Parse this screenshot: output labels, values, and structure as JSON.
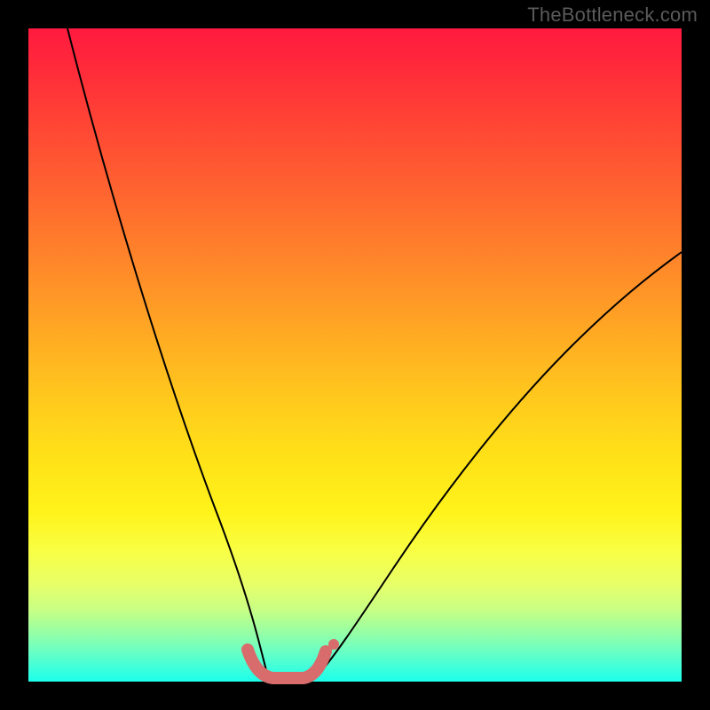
{
  "watermark": "TheBottleneck.com",
  "colors": {
    "frame": "#000000",
    "curve": "#000000",
    "highlight": "#d86b6b",
    "gradient_top": "#ff1a3f",
    "gradient_bottom": "#1dffea"
  },
  "chart_data": {
    "type": "line",
    "title": "",
    "xlabel": "",
    "ylabel": "",
    "xlim": [
      0,
      100
    ],
    "ylim": [
      0,
      100
    ],
    "grid": false,
    "legend": false,
    "note": "No axis ticks or labels are rendered; values are estimated from pixel positions on a 0–100 normalized scale (origin bottom-left). Higher y corresponds to the red region, y≈0 is the green region.",
    "series": [
      {
        "name": "left-branch",
        "x": [
          6,
          10,
          14,
          18,
          22,
          26,
          28,
          30,
          32,
          33.5,
          35,
          36
        ],
        "y": [
          100,
          84,
          68,
          52,
          37,
          23,
          16,
          10,
          5,
          2.5,
          1,
          0.5
        ]
      },
      {
        "name": "right-branch",
        "x": [
          44,
          46,
          50,
          55,
          60,
          66,
          72,
          78,
          84,
          90,
          96,
          100
        ],
        "y": [
          1,
          3,
          9,
          17,
          25,
          33,
          40,
          47,
          53,
          58,
          63,
          66
        ]
      },
      {
        "name": "trough-highlight",
        "x": [
          33,
          34.5,
          36,
          38,
          40,
          42,
          43.5,
          45
        ],
        "y": [
          4,
          2,
          0.8,
          0.4,
          0.4,
          0.8,
          2,
          4
        ]
      }
    ],
    "markers": [
      {
        "name": "highlight-end-dot",
        "x": 46,
        "y": 5
      }
    ]
  }
}
